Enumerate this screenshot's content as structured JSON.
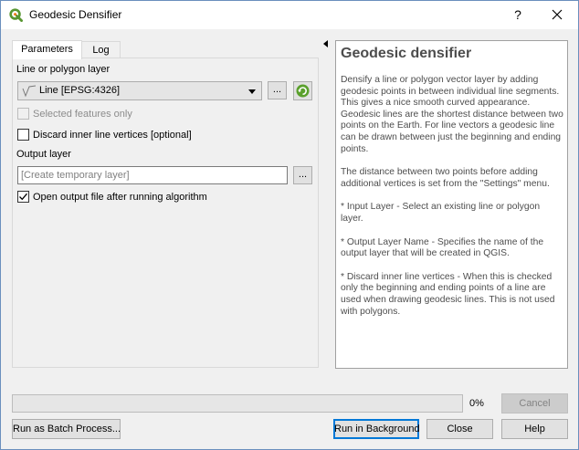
{
  "window": {
    "title": "Geodesic Densifier",
    "help_glyph": "?",
    "close_icon": "close-icon"
  },
  "tabs": [
    {
      "label": "Parameters",
      "active": true
    },
    {
      "label": "Log",
      "active": false
    }
  ],
  "params": {
    "layer_label": "Line or polygon layer",
    "layer_value": "Line [EPSG:4326]",
    "layer_icon": "line-layer-icon",
    "browse_label": "...",
    "iterate_icon": "iterate-icon",
    "selected_only_label": "Selected features only",
    "selected_only_checked": false,
    "selected_only_enabled": false,
    "discard_label": "Discard inner line vertices [optional]",
    "discard_checked": false,
    "output_label": "Output layer",
    "output_placeholder": "[Create temporary layer]",
    "output_value": "",
    "output_browse_label": "...",
    "open_output_label": "Open output file after running algorithm",
    "open_output_checked": true
  },
  "help": {
    "title": "Geodesic densifier",
    "paragraphs": [
      "Densify a line or polygon vector layer by adding geodesic points in between individual line segments. This gives a nice smooth curved appearance. Geodesic lines are the shortest distance between two points on the Earth. For line vectors a geodesic line can be drawn between just the beginning and ending points.",
      "The distance between two points before adding additional vertices is set from the \"Settings\" menu.",
      "* Input Layer - Select an existing line or polygon layer.",
      "* Output Layer Name - Specifies the name of the output layer that will be created in QGIS.",
      "* Discard inner line vertices - When this is checked only the beginning and ending points of a line are used when drawing geodesic lines. This is not used with polygons."
    ]
  },
  "progress": {
    "value": 0,
    "text": "0%"
  },
  "buttons": {
    "cancel": "Cancel",
    "batch": "Run as Batch Process...",
    "run": "Run in Background",
    "close": "Close",
    "help": "Help"
  },
  "colors": {
    "accent": "#0078d7",
    "qgis_green": "#589632",
    "help_text": "#4d4d4d"
  }
}
